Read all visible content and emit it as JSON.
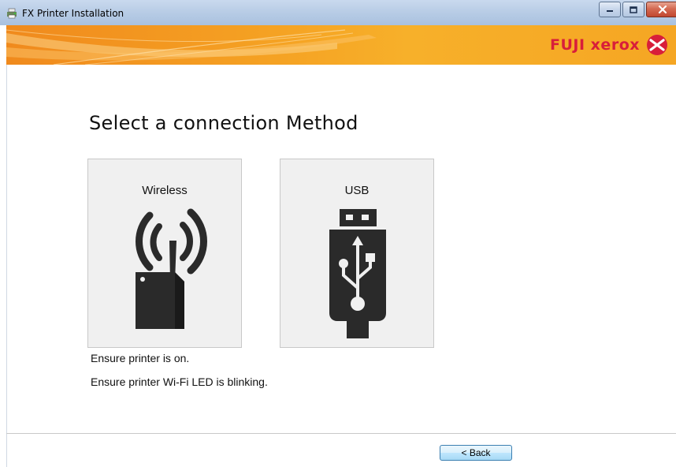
{
  "window": {
    "title": "FX Printer Installation",
    "icon": "printer-setup-icon",
    "controls": {
      "minimize_icon": "minimize-icon",
      "maximize_icon": "maximize-icon",
      "close_icon": "close-icon"
    }
  },
  "banner": {
    "brand": "FUJI xerox",
    "logo_icon": "fuji-xerox-logo-icon",
    "colors": {
      "orange": "#f5a223",
      "brand_red": "#d81e3a"
    }
  },
  "main": {
    "heading": "Select a connection Method",
    "options": [
      {
        "label": "Wireless",
        "icon": "wireless-router-icon"
      },
      {
        "label": "USB",
        "icon": "usb-drive-icon"
      }
    ],
    "notes": [
      "Ensure printer is on.",
      "Ensure printer Wi-Fi LED is blinking."
    ]
  },
  "footer": {
    "back_label": "< Back"
  }
}
